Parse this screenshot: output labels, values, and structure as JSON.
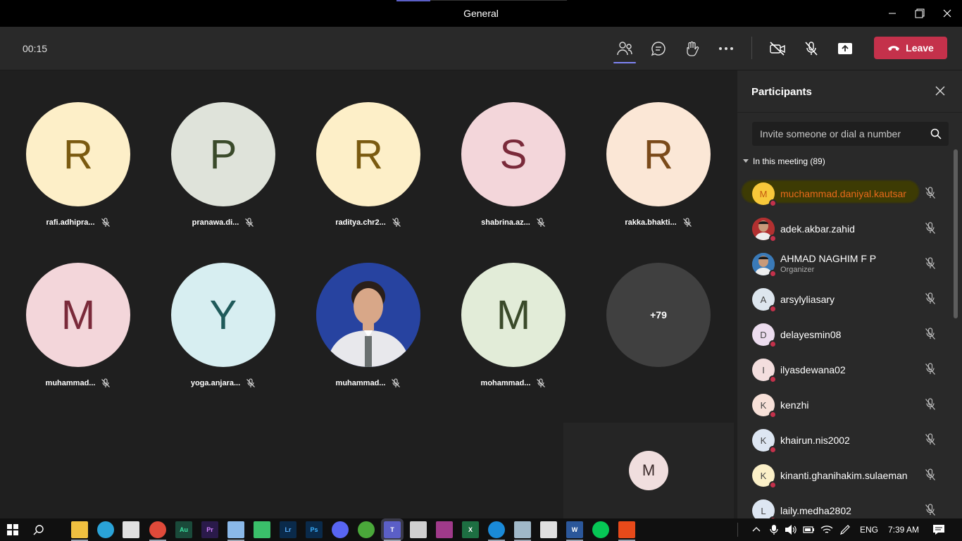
{
  "window": {
    "title": "General"
  },
  "toolbar": {
    "timer": "00:15",
    "leave_label": "Leave"
  },
  "tiles": [
    {
      "initial": "R",
      "name": "rafi.adhipra...",
      "bg": "#fdefc8",
      "fg": "#7a5a10"
    },
    {
      "initial": "P",
      "name": "pranawa.di...",
      "bg": "#dfe3da",
      "fg": "#3a4a2a"
    },
    {
      "initial": "R",
      "name": "raditya.chr2...",
      "bg": "#fdefc8",
      "fg": "#7a5a10"
    },
    {
      "initial": "S",
      "name": "shabrina.az...",
      "bg": "#f3d6da",
      "fg": "#7a2a3a"
    },
    {
      "initial": "R",
      "name": "rakka.bhakti...",
      "bg": "#fbe7d6",
      "fg": "#7a4a1a"
    },
    {
      "initial": "M",
      "name": "muhammad...",
      "bg": "#f3d6da",
      "fg": "#7a2a3a"
    },
    {
      "initial": "Y",
      "name": "yoga.anjara...",
      "bg": "#d7eef1",
      "fg": "#1f5a5a"
    },
    {
      "initial": "",
      "name": "muhammad...",
      "bg": "#2a3d8a",
      "fg": "#fff"
    },
    {
      "initial": "M",
      "name": "mohammad...",
      "bg": "#e2ecd8",
      "fg": "#3a4a2a"
    },
    {
      "initial": "+79",
      "name": "",
      "bg": "#404040",
      "fg": "#fff"
    }
  ],
  "self_view": {
    "initial": "M"
  },
  "panel": {
    "title": "Participants",
    "invite_placeholder": "Invite someone or dial a number",
    "group_label": "In this meeting (89)",
    "participants": [
      {
        "initial": "M",
        "name": "muchammad.daniyal.kautsar",
        "bg": "#f7c83a",
        "highlight": true,
        "color": "#e86a1a"
      },
      {
        "initial": "",
        "name": "adek.akbar.zahid",
        "bg": "#b23030",
        "photo": true
      },
      {
        "initial": "",
        "name": "AHMAD NAGHIM F P",
        "role": "Organizer",
        "bg": "#3a7ab8",
        "photo": true
      },
      {
        "initial": "A",
        "name": "arsylyliasary",
        "bg": "#dde6ee"
      },
      {
        "initial": "D",
        "name": "delayesmin08",
        "bg": "#ecdcee"
      },
      {
        "initial": "I",
        "name": "ilyasdewana02",
        "bg": "#f3dede"
      },
      {
        "initial": "K",
        "name": "kenzhi",
        "bg": "#f7e0d8"
      },
      {
        "initial": "K",
        "name": "khairun.nis2002",
        "bg": "#dde6f2"
      },
      {
        "initial": "K",
        "name": "kinanti.ghanihakim.sulaeman",
        "bg": "#fbf0c8"
      },
      {
        "initial": "L",
        "name": "laily.medha2802",
        "bg": "#dde6f2"
      }
    ]
  },
  "taskbar": {
    "apps": [
      {
        "icon": "explorer-icon",
        "color": "#f0c040"
      },
      {
        "icon": "edge-icon",
        "color": "#2aa3d8"
      },
      {
        "icon": "store-icon",
        "color": "#e0e0e0"
      },
      {
        "icon": "chrome-icon",
        "color": "#e04a3a"
      },
      {
        "icon": "audition-icon",
        "color": "#1a4a3a",
        "text": "Au",
        "fg": "#3ae0a0"
      },
      {
        "icon": "premiere-icon",
        "color": "#2a1a4a",
        "text": "Pr",
        "fg": "#d080ff"
      },
      {
        "icon": "notepad-icon",
        "color": "#8ab8e8"
      },
      {
        "icon": "media-icon",
        "color": "#3ac06a"
      },
      {
        "icon": "lightroom-icon",
        "color": "#0a2a4a",
        "text": "Lr",
        "fg": "#5ab0ff"
      },
      {
        "icon": "photoshop-icon",
        "color": "#0a2a4a",
        "text": "Ps",
        "fg": "#3ab0ff"
      },
      {
        "icon": "discord-icon",
        "color": "#5865f2"
      },
      {
        "icon": "utorrent-icon",
        "color": "#4aa83a"
      },
      {
        "icon": "teams-icon",
        "color": "#5b5fc7",
        "text": "T",
        "fg": "#fff"
      },
      {
        "icon": "app-icon",
        "color": "#d0d0d0"
      },
      {
        "icon": "winrar-icon",
        "color": "#a03a8a"
      },
      {
        "icon": "excel-icon",
        "color": "#1d6f42",
        "text": "X",
        "fg": "#fff"
      },
      {
        "icon": "ie-icon",
        "color": "#1a8ad8"
      },
      {
        "icon": "photos-icon",
        "color": "#a0b8c8"
      },
      {
        "icon": "vpn-icon",
        "color": "#e0e0e0"
      },
      {
        "icon": "word-icon",
        "color": "#2b579a",
        "text": "W",
        "fg": "#fff"
      },
      {
        "icon": "line-icon",
        "color": "#06c755"
      },
      {
        "icon": "office-icon",
        "color": "#e84a1a"
      }
    ],
    "lang": "ENG",
    "time": "7:39 AM"
  }
}
